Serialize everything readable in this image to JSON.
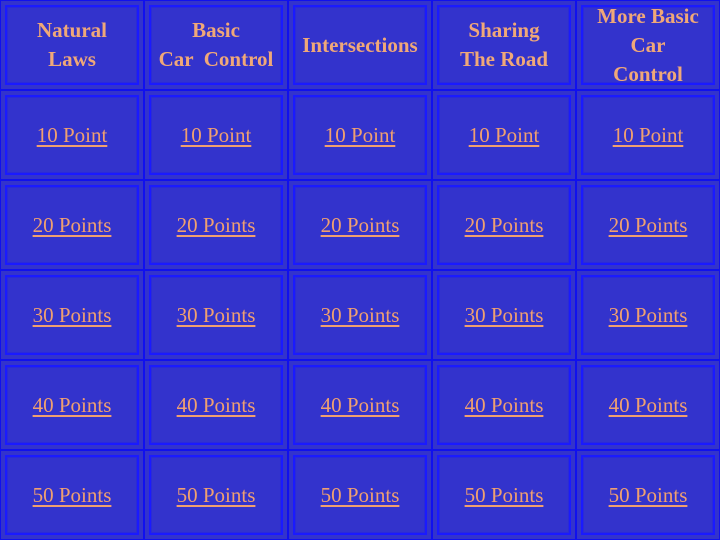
{
  "categories": [
    {
      "line1": "Natural",
      "line2": "Laws"
    },
    {
      "line1": "Basic",
      "line2": "Car  Control"
    },
    {
      "line1": "Intersections",
      "line2": ""
    },
    {
      "line1": "Sharing",
      "line2": "The Road"
    },
    {
      "line1": "More Basic",
      "line2": "Car",
      "line3": "Control"
    }
  ],
  "rows": [
    "10 Point",
    "20 Points",
    "30 Points",
    "40 Points",
    "50 Points"
  ],
  "colors": {
    "background": "#3333cc",
    "border": "#1a1aff",
    "text": "#f0a070"
  }
}
